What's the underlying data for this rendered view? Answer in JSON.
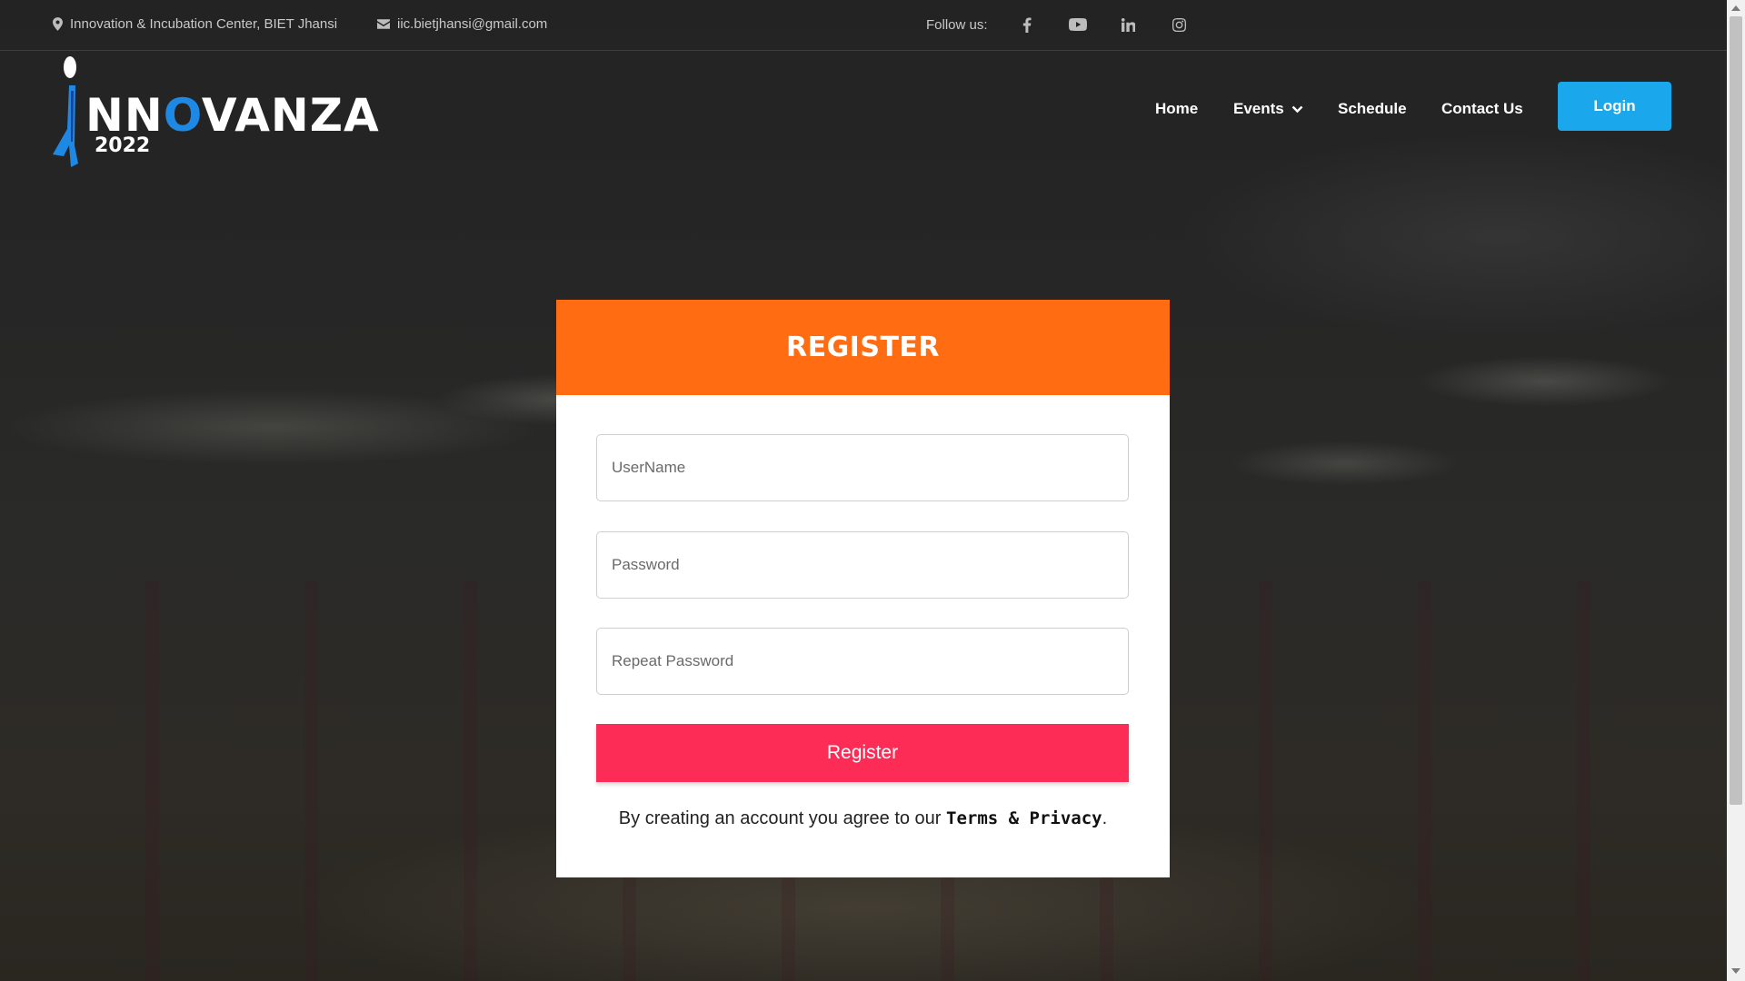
{
  "topbar": {
    "address": "Innovation & Incubation Center, BIET Jhansi",
    "email": "iic.bietjhansi@gmail.com",
    "follow_label": "Follow us:",
    "social_icons": [
      "facebook-icon",
      "youtube-icon",
      "linkedin-icon",
      "instagram-icon"
    ]
  },
  "logo": {
    "text_prefix": "NN",
    "text_o": "O",
    "text_v": "V",
    "text_suffix": "ANZA",
    "year": "2022"
  },
  "nav": {
    "items": [
      "Home",
      "Events",
      "Schedule",
      "Contact Us"
    ],
    "login_label": "Login"
  },
  "form": {
    "title": "REGISTER",
    "username_placeholder": "UserName",
    "password_placeholder": "Password",
    "repeat_placeholder": "Repeat Password",
    "submit_label": "Register",
    "terms_prefix": "By creating an account you agree to our ",
    "terms_link": "Terms & Privacy",
    "terms_suffix": "."
  },
  "colors": {
    "header_orange": "#ff6c11",
    "register_pink": "#fd2c56",
    "login_blue": "#1aa7ec",
    "logo_blue": "#1e88e5"
  }
}
